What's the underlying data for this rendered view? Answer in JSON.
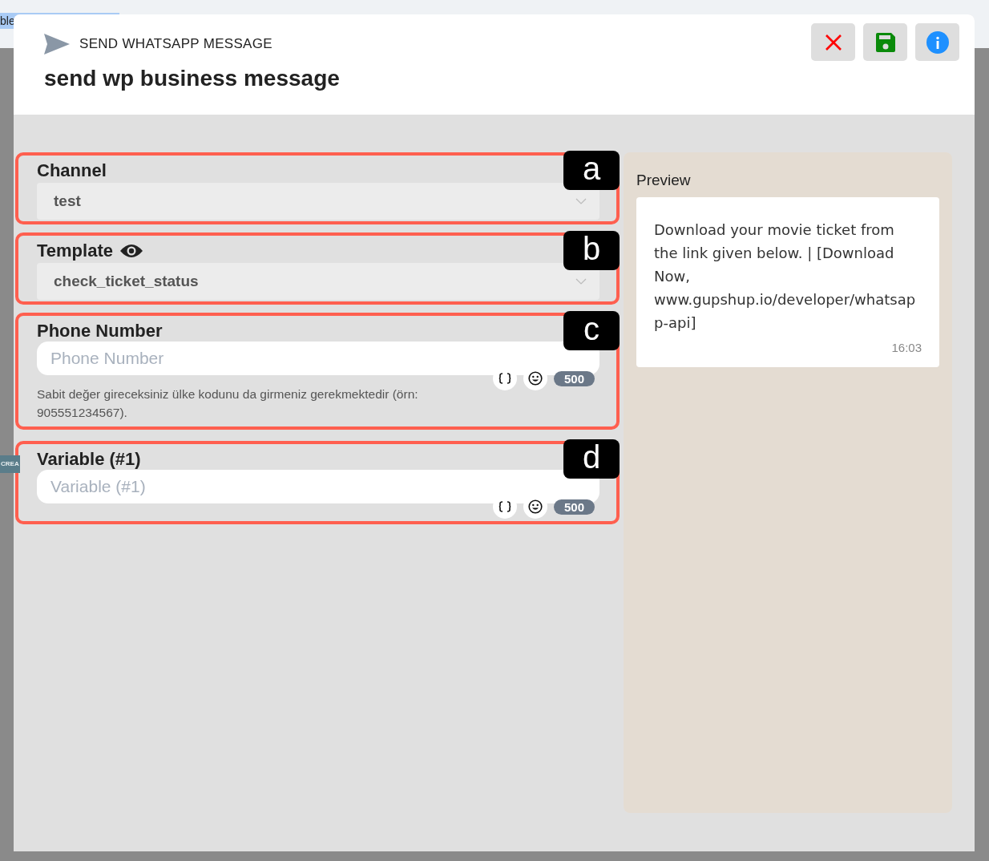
{
  "browser": {
    "tab_text": "ble"
  },
  "background": {
    "button": "CREA"
  },
  "dialog": {
    "kind_label": "SEND WHATSAPP MESSAGE",
    "title": "send wp business message",
    "actions": [
      {
        "kind": "close"
      },
      {
        "kind": "save"
      },
      {
        "kind": "info"
      }
    ]
  },
  "fields": [
    {
      "marker": "a",
      "label": "Channel",
      "kind": "select",
      "value": "test"
    },
    {
      "marker": "b",
      "label": "Template",
      "kind": "select_preview",
      "value": "check_ticket_status"
    },
    {
      "marker": "c",
      "label": "Phone Number",
      "kind": "text",
      "placeholder": "Phone Number",
      "counter": "500",
      "hint": "Sabit değer gireceksiniz ülke kodunu da girmeniz gerekmektedir (örn: 905551234567)."
    },
    {
      "marker": "d",
      "label": "Variable (#1)",
      "kind": "text",
      "placeholder": "Variable (#1)",
      "counter": "500"
    }
  ],
  "preview": {
    "label": "Preview",
    "message": "Download your movie ticket from the link given below. | [Download Now, www.gupshup.io/developer/whatsapp-api]",
    "time": "16:03"
  }
}
